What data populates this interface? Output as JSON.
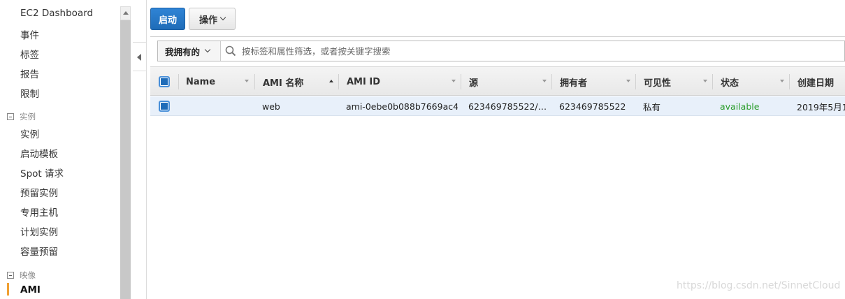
{
  "sidebar": {
    "items": [
      {
        "label": "EC2 Dashboard"
      },
      {
        "label": "事件"
      },
      {
        "label": "标签"
      },
      {
        "label": "报告"
      },
      {
        "label": "限制"
      }
    ],
    "sections": [
      {
        "title": "实例",
        "items": [
          "实例",
          "启动模板",
          "Spot 请求",
          "预留实例",
          "专用主机",
          "计划实例",
          "容量预留"
        ]
      },
      {
        "title": "映像",
        "items": [
          "AMI"
        ]
      }
    ],
    "active_item": "AMI"
  },
  "toolbar": {
    "launch_label": "启动",
    "actions_label": "操作"
  },
  "filter": {
    "owner_label": "我拥有的",
    "search_placeholder": "按标签和属性筛选，或者按关键字搜索"
  },
  "table": {
    "columns": [
      "Name",
      "AMI 名称",
      "AMI ID",
      "源",
      "拥有者",
      "可见性",
      "状态",
      "创建日期"
    ],
    "sorted_column": "AMI 名称",
    "rows": [
      {
        "name": "",
        "ami_name": "web",
        "ami_id": "ami-0ebe0b088b7669ac4",
        "source": "623469785522/…",
        "owner": "623469785522",
        "visibility": "私有",
        "status": "available",
        "created": "2019年5月1"
      }
    ]
  },
  "colors": {
    "primary": "#1f6cb8",
    "status_available": "#2a9d2a",
    "active_marker": "#f0a033"
  },
  "watermark": "https://blog.csdn.net/SinnetCloud"
}
